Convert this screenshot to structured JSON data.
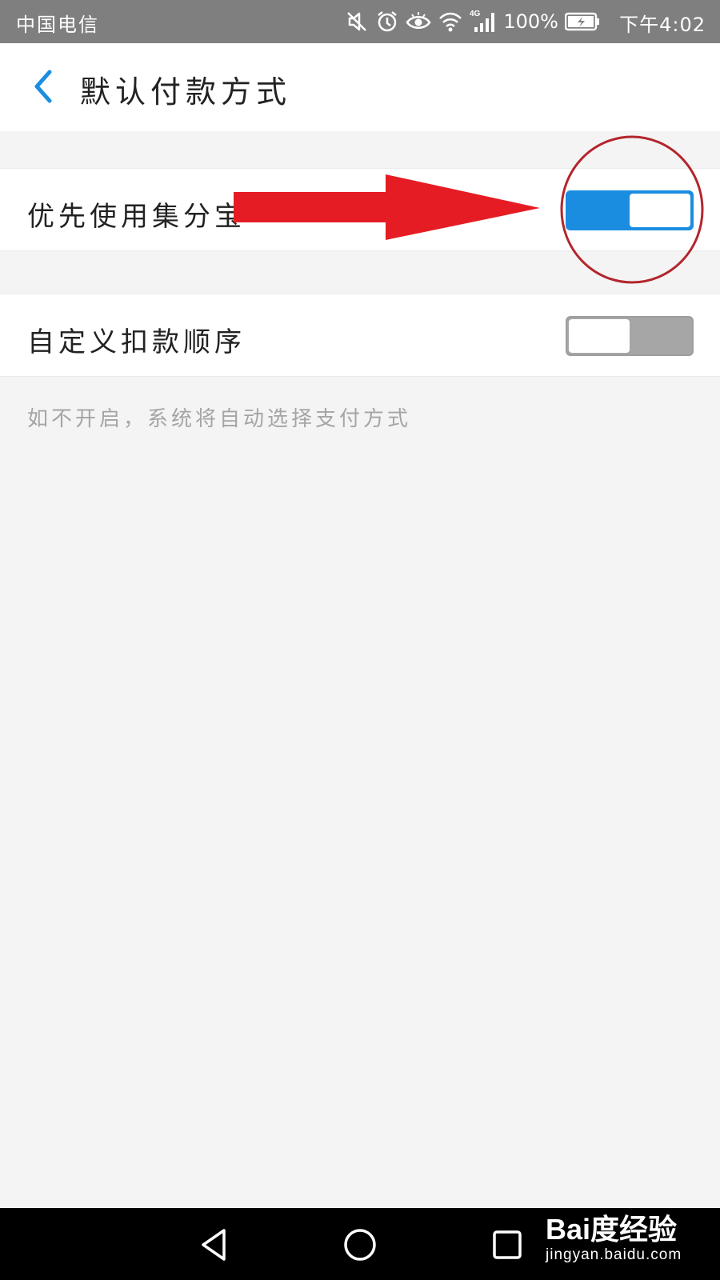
{
  "status_bar": {
    "carrier": "中国电信",
    "network": "4G",
    "battery_percent": "100%",
    "time": "下午4:02",
    "icons": [
      "mute-icon",
      "alarm-icon",
      "eye-care-icon",
      "wifi-icon",
      "signal-icon",
      "battery-charging-icon"
    ]
  },
  "header": {
    "back_icon": "chevron-left-icon",
    "title": "默认付款方式"
  },
  "settings": [
    {
      "label": "优先使用集分宝",
      "enabled": true
    },
    {
      "label": "自定义扣款顺序",
      "enabled": false
    }
  ],
  "hint": "如不开启，系统将自动选择支付方式",
  "colors": {
    "accent": "#1a8de0",
    "toggle_off": "#a6a6a6",
    "annotation_red": "#e51c23",
    "status_bar": "#7f7f7f",
    "background": "#f4f4f4"
  },
  "navigation_bar": {
    "icons": [
      "back-triangle-icon",
      "home-circle-icon",
      "recent-square-icon"
    ]
  },
  "watermark": {
    "brand": "Bai度经验",
    "url": "jingyan.baidu.com"
  }
}
